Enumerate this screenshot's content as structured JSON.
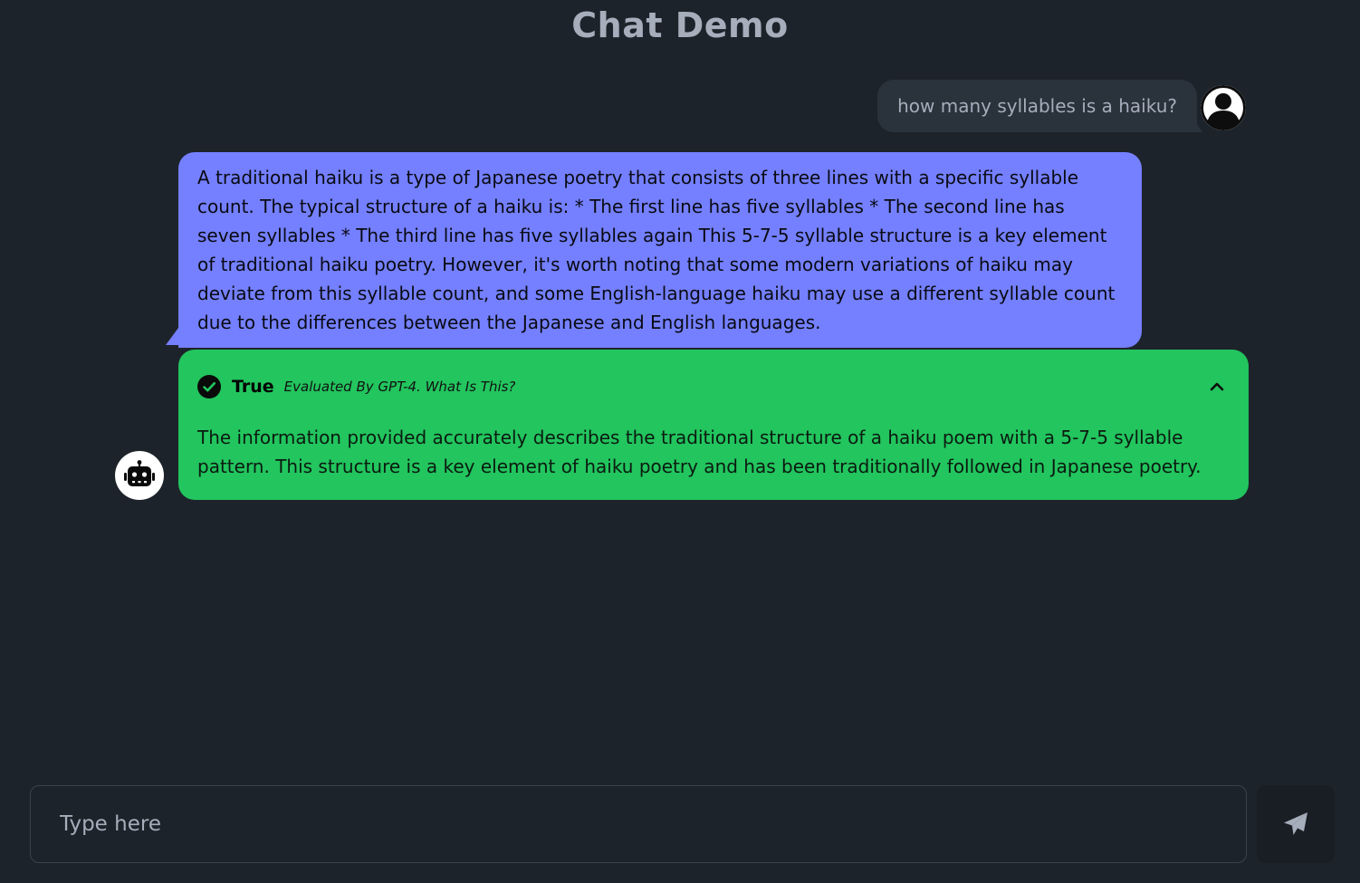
{
  "app": {
    "title": "Chat Demo"
  },
  "messages": {
    "user": {
      "text": "how many syllables is a haiku?"
    },
    "assistant": {
      "text": "A traditional haiku is a type of Japanese poetry that consists of three lines with a specific syllable count. The typical structure of a haiku is: * The first line has five syllables * The second line has seven syllables * The third line has five syllables again This 5-7-5 syllable structure is a key element of traditional haiku poetry. However, it's worth noting that some modern variations of haiku may deviate from this syllable count, and some English-language haiku may use a different syllable count due to the differences between the Japanese and English languages."
    }
  },
  "evaluation": {
    "verdict": "True",
    "evaluated_by": "Evaluated By GPT-4. What Is This?",
    "explanation": "The information provided accurately describes the traditional structure of a haiku poem with a 5-7-5 syllable pattern. This structure is a key element of haiku poetry and has been traditionally followed in Japanese poetry.",
    "icons": {
      "status": "check-circle-icon",
      "toggle": "chevron-up-icon"
    }
  },
  "input": {
    "placeholder": "Type here",
    "value": ""
  },
  "icons": {
    "user_avatar": "user-avatar-icon",
    "bot_avatar": "robot-icon",
    "send": "paper-plane-icon"
  },
  "colors": {
    "background": "#1d232a",
    "user_bubble": "#2a323c",
    "assistant_bubble": "#7480ff",
    "evaluation_true": "#22c55e",
    "title_text": "#a6adbb"
  }
}
